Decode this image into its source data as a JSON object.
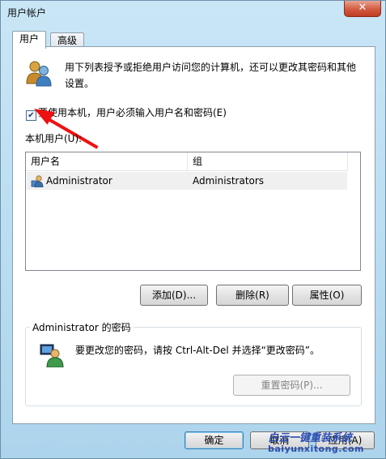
{
  "window": {
    "title": "用户帐户",
    "close_label": "✕"
  },
  "tabs": [
    {
      "label": "用户",
      "active": true
    },
    {
      "label": "高级",
      "active": false
    }
  ],
  "intro": {
    "icon": "users-icon",
    "line1": "用下列表授予或拒绝用户访问您的计算机，还可以更改其密码和其他",
    "line2": "设置。"
  },
  "require_login": {
    "checked": true,
    "check_mark": "✔",
    "label": "要使用本机，用户必须输入用户名和密码(E)"
  },
  "user_list": {
    "label": "本机用户(U):",
    "columns": [
      "用户名",
      "组"
    ],
    "rows": [
      {
        "icon": "user-icon",
        "username": "Administrator",
        "group": "Administrators"
      }
    ]
  },
  "list_buttons": {
    "add": "添加(D)...",
    "remove": "删除(R)",
    "properties": "属性(O)"
  },
  "password_group": {
    "legend": "Administrator 的密码",
    "icon": "user-key-icon",
    "instruction": "要更改您的密码，请按 Ctrl-Alt-Del 并选择“更改密码”。",
    "reset_button": "重置密码(P)..."
  },
  "dialog_buttons": {
    "ok": "确定",
    "cancel": "取消",
    "apply": "应用(A)"
  },
  "watermark": {
    "text_cn": "白云一键重装系统",
    "text_en": "baiyunxitong.com"
  },
  "colors": {
    "accent_arrow": "#ee1111",
    "window_frame": "#b8dcf1",
    "watermark": "#2b4fb2"
  }
}
